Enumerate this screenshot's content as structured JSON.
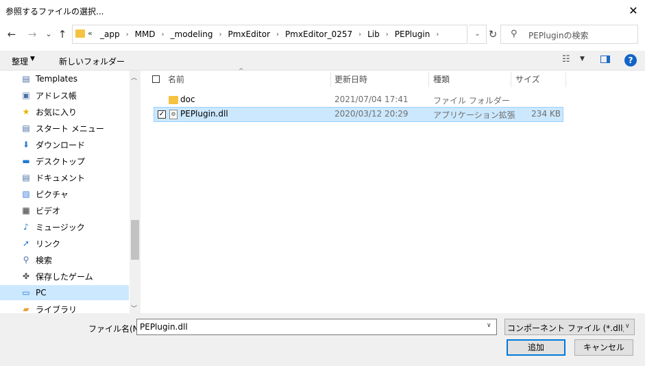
{
  "window": {
    "title": "参照するファイルの選択...",
    "close_glyph": "✕"
  },
  "nav": {
    "back_glyph": "←",
    "forward_glyph": "→",
    "recent_glyph": "⌄",
    "up_glyph": "↑",
    "address_prefix": "«",
    "breadcrumbs": [
      "_app",
      "MMD",
      "_modeling",
      "PmxEditor",
      "PmxEditor_0257",
      "Lib",
      "PEPlugin"
    ],
    "crumb_separator": "›",
    "refresh_glyph": "↻",
    "search_placeholder": "PEPluginの検索",
    "search_icon_glyph": "⚲"
  },
  "toolbar": {
    "organize_label": "整理",
    "caret": "▼",
    "new_folder_label": "新しいフォルダー",
    "help_glyph": "?",
    "view_glyph": "☷"
  },
  "navpane": {
    "items": [
      {
        "label": "Templates",
        "icon": "document-icon",
        "glyph": "▤"
      },
      {
        "label": "アドレス帳",
        "icon": "contacts-icon",
        "glyph": "▣"
      },
      {
        "label": "お気に入り",
        "icon": "star-icon",
        "glyph": "★"
      },
      {
        "label": "スタート メニュー",
        "icon": "document-icon",
        "glyph": "▤"
      },
      {
        "label": "ダウンロード",
        "icon": "download-icon",
        "glyph": "⬇"
      },
      {
        "label": "デスクトップ",
        "icon": "desktop-icon",
        "glyph": "▬"
      },
      {
        "label": "ドキュメント",
        "icon": "document-icon",
        "glyph": "▤"
      },
      {
        "label": "ピクチャ",
        "icon": "picture-icon",
        "glyph": "▨"
      },
      {
        "label": "ビデオ",
        "icon": "video-icon",
        "glyph": "▦"
      },
      {
        "label": "ミュージック",
        "icon": "music-icon",
        "glyph": "♪"
      },
      {
        "label": "リンク",
        "icon": "link-icon",
        "glyph": "➚"
      },
      {
        "label": "検索",
        "icon": "search-icon",
        "glyph": "⚲"
      },
      {
        "label": "保存したゲーム",
        "icon": "game-icon",
        "glyph": "✤"
      },
      {
        "label": "PC",
        "icon": "pc-icon",
        "glyph": "▭"
      },
      {
        "label": "ライブラリ",
        "icon": "library-icon",
        "glyph": "▰"
      }
    ],
    "scroll_up": "︿",
    "scroll_down": "﹀"
  },
  "filelist": {
    "columns": [
      "名前",
      "更新日時",
      "種類",
      "サイズ"
    ],
    "sort_glyph": "^",
    "check_glyph": "✓",
    "rows": [
      {
        "name": "doc",
        "modified": "2021/07/04 17:41",
        "type": "ファイル フォルダー",
        "size": ""
      },
      {
        "name": "PEPlugin.dll",
        "modified": "2020/03/12 20:29",
        "type": "アプリケーション拡張",
        "size": "234 KB"
      }
    ]
  },
  "footer": {
    "filename_label": "ファイル名(N):",
    "filename_value": "PEPlugin.dll",
    "filter_value": "コンポーネント ファイル (*.dll;*.tlb;*.o",
    "dropdown_glyph": "∨",
    "add_button": "追加",
    "cancel_button": "キャンセル"
  },
  "colors": {
    "selection": "#cce8ff",
    "accent": "#0078d7",
    "folder": "#f5c342"
  }
}
